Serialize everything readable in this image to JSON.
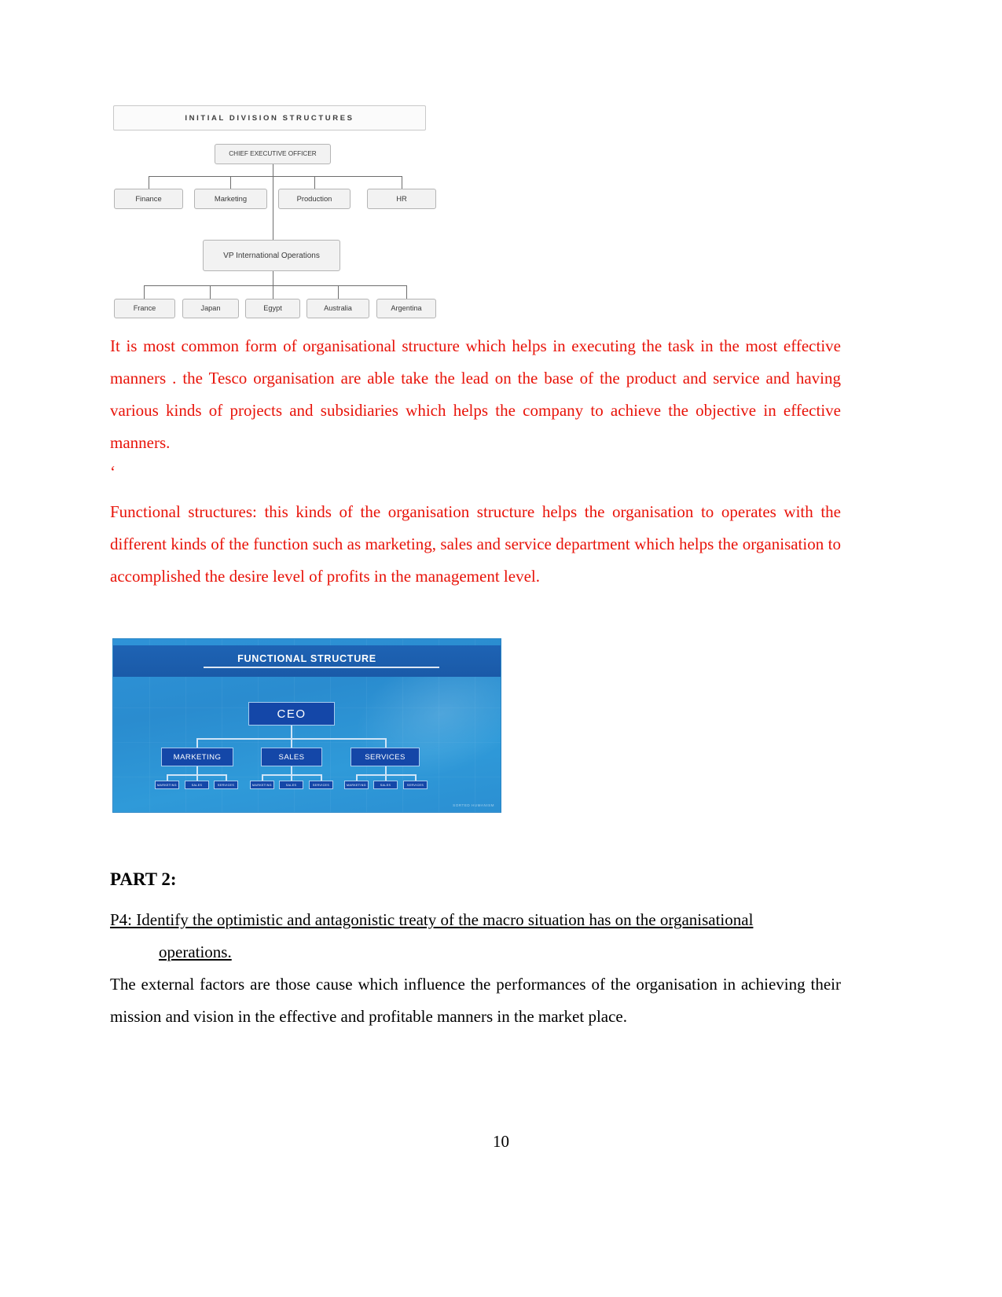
{
  "document": {
    "page_number": "10"
  },
  "diagram_initial_division": {
    "title": "INITIAL DIVISION STRUCTURES",
    "ceo": "CHIEF EXECUTIVE OFFICER",
    "level2": [
      "Finance",
      "Marketing",
      "Production",
      "HR"
    ],
    "vp": "VP International Operations",
    "level4": [
      "France",
      "Japan",
      "Egypt",
      "Australia",
      "Argentina"
    ]
  },
  "paragraph_common_form": {
    "text": "It is most common  form of  organisational structure which helps in  executing the task in the most effective manners . the Tesco organisation are able take the lead on the  base of the product and service and having various kinds of projects and subsidiaries which helps the company to achieve the objective in effective manners."
  },
  "stray_quote": {
    "text": "‘"
  },
  "paragraph_functional_structures": {
    "text": "Functional structures: this kinds of the organisation structure helps the organisation to operates with the different kinds of the  function  such as marketing, sales and service department which helps the organisation to accomplished the desire level of profits  in the management level."
  },
  "diagram_functional_structure": {
    "title": "FUNCTIONAL STRUCTURE",
    "ceo": "CEO",
    "level2": [
      "MARKETING",
      "SALES",
      "SERVICES"
    ],
    "level3_marketing": [
      "MARKETING",
      "SALES",
      "SERVICES"
    ],
    "level3_sales": [
      "MARKETING",
      "SALES",
      "SERVICES"
    ],
    "level3_services": [
      "MARKETING",
      "SALES",
      "SERVICES"
    ],
    "watermark": "SORTED HUMANISM",
    "colors": {
      "background": "#2e93d8",
      "header": "#1e63b4",
      "box_fill": "#1447a8",
      "box_border": "#a8ccee"
    }
  },
  "part2": {
    "heading": "PART 2:",
    "p4_heading_line1": "P4: Identify the optimistic and antagonistic treaty of the macro situation has on the organisational",
    "p4_heading_line2": "operations.",
    "body": " The external factors are those cause which influence the performances of the organisation in achieving their mission and vision in the effective and profitable manners in the market place."
  }
}
